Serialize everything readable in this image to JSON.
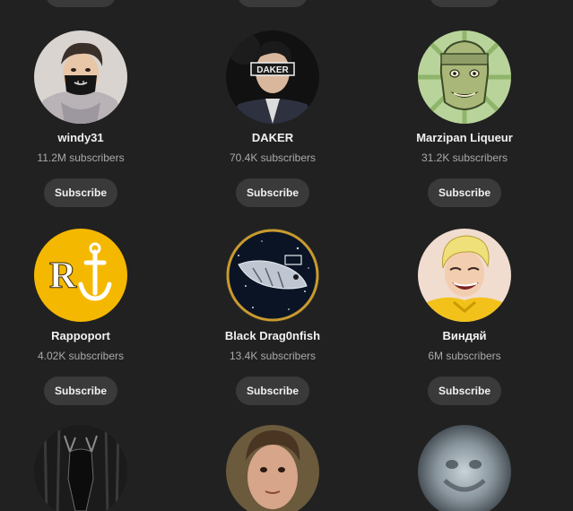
{
  "channels": [
    {
      "name": "windy31",
      "subscribers": "11.2M subscribers",
      "button": "Subscribe",
      "avatar_icon": "masked-man-avatar"
    },
    {
      "name": "DAKER",
      "subscribers": "70.4K subscribers",
      "button": "Subscribe",
      "avatar_icon": "daker-avatar",
      "avatar_text": "DAKER"
    },
    {
      "name": "Marzipan Liqueur",
      "subscribers": "31.2K subscribers",
      "button": "Subscribe",
      "avatar_icon": "green-cartoon-face-avatar"
    },
    {
      "name": "Rappoport",
      "subscribers": "4.02K subscribers",
      "button": "Subscribe",
      "avatar_icon": "anchor-logo-avatar",
      "avatar_text": "R"
    },
    {
      "name": "Black Drag0nfish",
      "subscribers": "13.4K subscribers",
      "button": "Subscribe",
      "avatar_icon": "dragonfish-avatar"
    },
    {
      "name": "Виндяй",
      "subscribers": "6M subscribers",
      "button": "Subscribe",
      "avatar_icon": "blond-cartoon-avatar"
    },
    {
      "avatar_icon": "dark-forest-creature-avatar"
    },
    {
      "avatar_icon": "young-man-photo-avatar"
    },
    {
      "avatar_icon": "blurry-ghost-avatar"
    }
  ],
  "colors": {
    "background": "#212121",
    "button_bg": "#3a3a3a",
    "text_primary": "#f1f1f1",
    "text_secondary": "#aaaaaa",
    "rappoport_yellow": "#f5b800"
  }
}
